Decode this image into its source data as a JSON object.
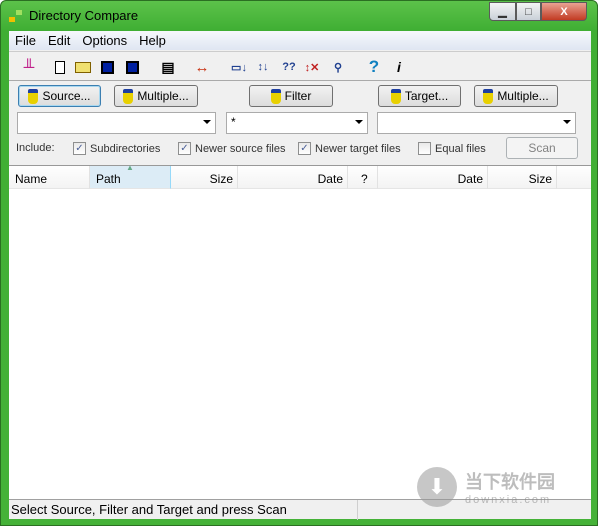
{
  "window": {
    "title": "Directory Compare",
    "minimize": "▁",
    "maximize": "□",
    "close": "X"
  },
  "menu": [
    "File",
    "Edit",
    "Options",
    "Help"
  ],
  "toolbar": {
    "icons": [
      "scan-tool-icon",
      "new-file-icon",
      "open-folder-icon",
      "save-icon",
      "save-as-icon",
      "properties-icon",
      "swap-icon",
      "copy-to-target-icon",
      "sync-icon",
      "compare-unknown-icon",
      "delete-target-icon",
      "link-icon",
      "help-icon",
      "about-icon"
    ]
  },
  "buttons": {
    "source": "Source...",
    "source_multiple": "Multiple...",
    "filter": "Filter",
    "target": "Target...",
    "target_multiple": "Multiple..."
  },
  "combos": {
    "source": "",
    "filter": "*",
    "target": ""
  },
  "include": {
    "label": "Include:",
    "options": [
      {
        "label": "Subdirectories",
        "checked": true
      },
      {
        "label": "Newer source files",
        "checked": true
      },
      {
        "label": "Newer target files",
        "checked": true
      },
      {
        "label": "Equal files",
        "checked": false
      }
    ],
    "scan": "Scan"
  },
  "columns": [
    "Name",
    "Path",
    "Size",
    "Date",
    "?",
    "Date",
    "Size"
  ],
  "status": "Select Source, Filter and Target and press Scan",
  "watermark": {
    "title": "当下软件园",
    "site": "downxia.com"
  }
}
